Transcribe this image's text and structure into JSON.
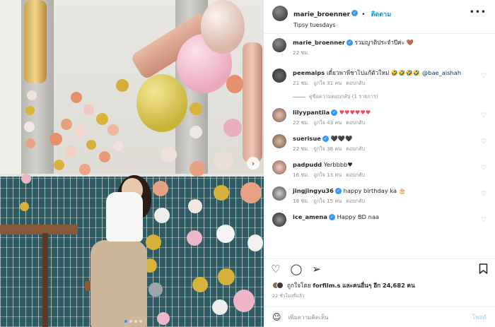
{
  "header": {
    "username": "marie_broenner",
    "follow_label": "ติดตาม",
    "location": "Tipsy tuesdays",
    "more_icon": "more-horizontal-icon"
  },
  "caption": {
    "username": "marie_broenner",
    "text": "รวมญาติประจำปีค่ะ 🤎",
    "time": "22 ชม."
  },
  "comments": [
    {
      "username": "peemaips",
      "verified": false,
      "text": "เดี๋ยวพาพี่ชาไปแก้ตัวใหม่ 🤣🤣🤣🤣",
      "mention": "@bae_aishah",
      "time": "21 ชม.",
      "likes": "ถูกใจ 31 คน",
      "reply": "ตอบกลับ"
    },
    {
      "username": "lilyypantila",
      "verified": true,
      "text": "♥♥♥♥♥♥",
      "time": "22 ชม.",
      "likes": "ถูกใจ 43 คน",
      "reply": "ตอบกลับ"
    },
    {
      "username": "suerisue",
      "verified": true,
      "text": "🖤🖤🖤",
      "time": "22 ชม.",
      "likes": "ถูกใจ 36 คน",
      "reply": "ตอบกลับ"
    },
    {
      "username": "padpudd",
      "verified": false,
      "text": "Yerbbbb♥",
      "time": "16 ชม.",
      "likes": "ถูกใจ 13 คน",
      "reply": "ตอบกลับ"
    },
    {
      "username": "jingjingyu36",
      "verified": true,
      "text": "happy birthday ka 🎂",
      "time": "18 ชม.",
      "likes": "ถูกใจ 15 คน",
      "reply": "ตอบกลับ"
    },
    {
      "username": "ice_amena",
      "verified": true,
      "text": "Happy BD naa"
    }
  ],
  "view_replies": "ดูข้อความตอบกลับ (1 รายการ)",
  "actions": {
    "like_icon": "heart-icon",
    "comment_icon": "comment-icon",
    "share_icon": "share-icon",
    "save_icon": "bookmark-icon"
  },
  "likes_text": {
    "prefix": "ถูกใจโดย",
    "user": "forfilm.s",
    "mid": "และคนอื่นๆ อีก",
    "count": "24,682",
    "suffix": "คน"
  },
  "post_time": "22 ชั่วโมงที่แล้ว",
  "add_comment": {
    "placeholder": "เพิ่มความคิดเห็น",
    "post_label": "โพสต์",
    "emoji_icon": "smile-icon"
  },
  "colors": {
    "accent": "#0095f6",
    "verified": "#3897f0",
    "heart": "#ed4956",
    "muted": "#8e8e8e"
  }
}
